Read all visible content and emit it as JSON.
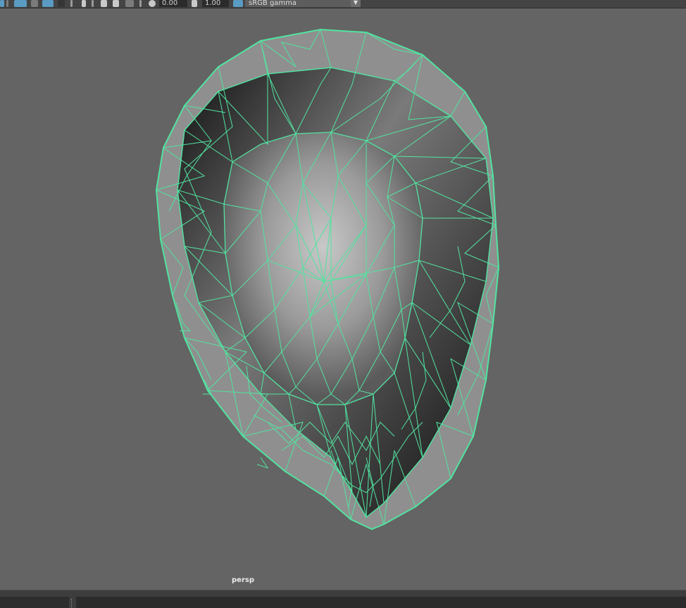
{
  "toolbar": {
    "exposure_value": "0.00",
    "gamma_value": "1.00",
    "color_space": "sRGB gamma",
    "icons": [
      "view-transform-icon",
      "grid-icon",
      "camera-icon",
      "wireframe-icon",
      "xray-icon",
      "isolate-icon",
      "film-gate-icon",
      "resolution-gate-icon",
      "safe-action-icon",
      "snapshot-icon",
      "exposure-icon",
      "gamma-icon",
      "color-manage-icon"
    ]
  },
  "viewport": {
    "camera_label": "persp",
    "wireframe_color": "#52e3a0",
    "background_color": "#646464"
  }
}
